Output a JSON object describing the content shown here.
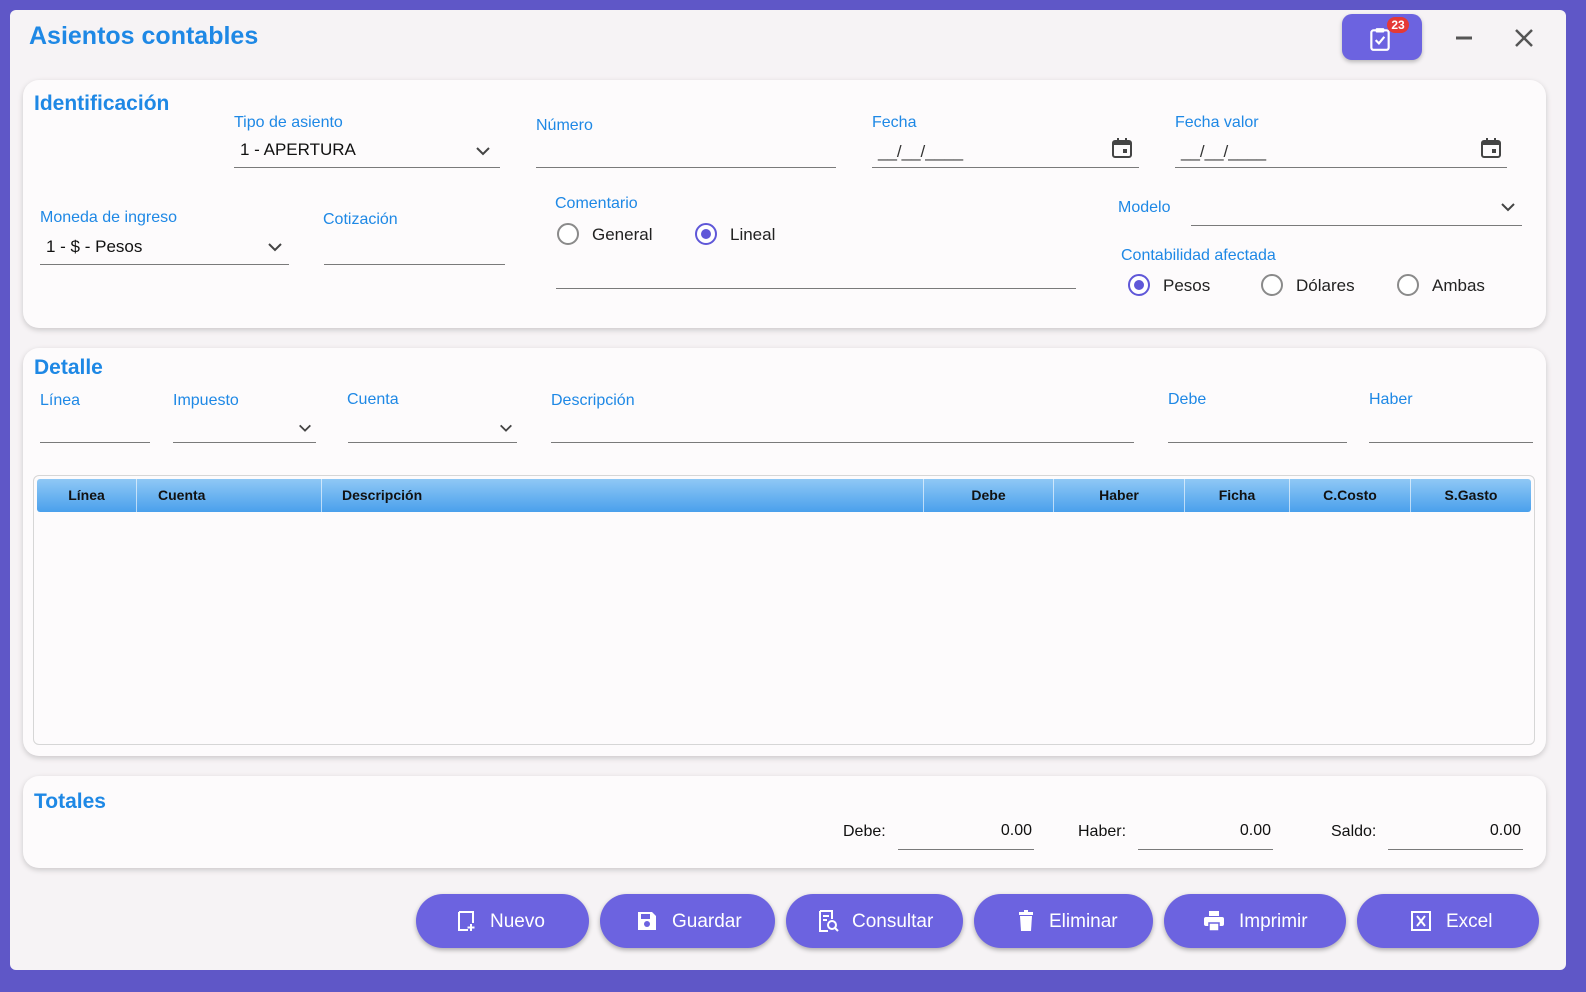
{
  "window": {
    "title": "Asientos contables",
    "notification_count": "23"
  },
  "identificacion": {
    "title": "Identificación",
    "tipo_asiento": {
      "label": "Tipo de asiento",
      "value": "1 - APERTURA"
    },
    "numero": {
      "label": "Número",
      "value": ""
    },
    "fecha": {
      "label": "Fecha",
      "mask": "__/__/____"
    },
    "fecha_valor": {
      "label": "Fecha valor",
      "mask": "__/__/____"
    },
    "moneda": {
      "label": "Moneda de ingreso",
      "value": "1 - $ - Pesos"
    },
    "cotizacion": {
      "label": "Cotización",
      "value": ""
    },
    "comentario": {
      "label": "Comentario",
      "options": [
        "General",
        "Lineal"
      ],
      "selected": "Lineal"
    },
    "modelo": {
      "label": "Modelo",
      "value": ""
    },
    "contabilidad": {
      "label": "Contabilidad afectada",
      "options": [
        "Pesos",
        "Dólares",
        "Ambas"
      ],
      "selected": "Pesos"
    }
  },
  "detalle": {
    "title": "Detalle",
    "fields": {
      "linea": "Línea",
      "impuesto": "Impuesto",
      "cuenta": "Cuenta",
      "descripcion": "Descripción",
      "debe": "Debe",
      "haber": "Haber"
    },
    "columns": [
      "Línea",
      "Cuenta",
      "Descripción",
      "Debe",
      "Haber",
      "Ficha",
      "C.Costo",
      "S.Gasto"
    ],
    "rows": []
  },
  "totales": {
    "title": "Totales",
    "debe_label": "Debe:",
    "debe": "0.00",
    "haber_label": "Haber:",
    "haber": "0.00",
    "saldo_label": "Saldo:",
    "saldo": "0.00"
  },
  "actions": {
    "nuevo": "Nuevo",
    "guardar": "Guardar",
    "consultar": "Consultar",
    "eliminar": "Eliminar",
    "imprimir": "Imprimir",
    "excel": "Excel"
  },
  "colors": {
    "accent": "#1e88e5",
    "button": "#6c63e0",
    "frame": "#5f57c7",
    "badge": "#e53935"
  }
}
